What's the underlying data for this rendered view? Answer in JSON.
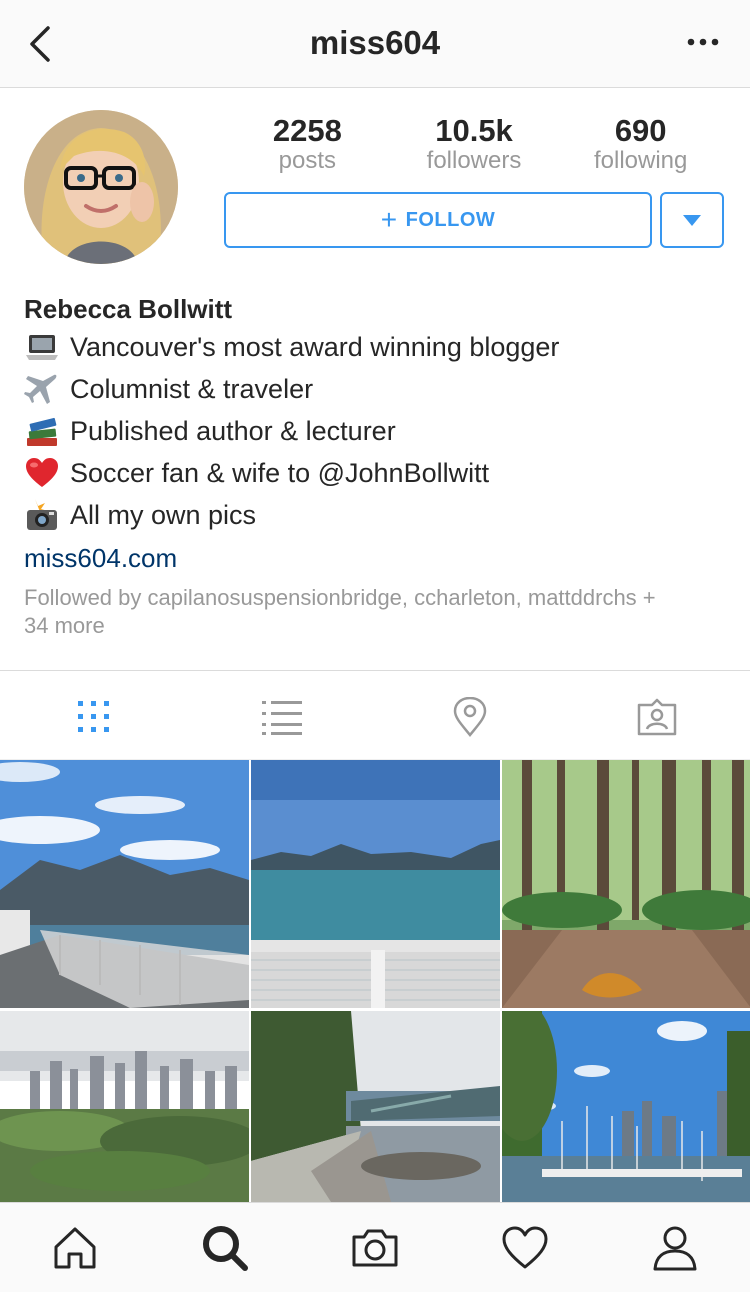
{
  "header": {
    "title": "miss604"
  },
  "profile": {
    "stats": [
      {
        "value": "2258",
        "label": "posts"
      },
      {
        "value": "10.5k",
        "label": "followers"
      },
      {
        "value": "690",
        "label": "following"
      }
    ],
    "follow_label": "FOLLOW",
    "name": "Rebecca Bollwitt",
    "bio_lines": [
      {
        "icon": "laptop-emoji",
        "text": "Vancouver's most award winning blogger"
      },
      {
        "icon": "airplane-emoji",
        "text": "Columnist & traveler"
      },
      {
        "icon": "books-emoji",
        "text": "Published author & lecturer"
      },
      {
        "icon": "heart-emoji",
        "text": "Soccer fan & wife to @JohnBollwitt"
      },
      {
        "icon": "camera-flash-emoji",
        "text": "All my own pics"
      }
    ],
    "website": "miss604.com",
    "followed_by": "Followed by capilanosuspensionbridge, ccharleton, mattddrchs + 34 more"
  },
  "tabs": [
    "grid-view",
    "list-view",
    "location",
    "tagged"
  ],
  "bottom_nav": [
    "home",
    "search",
    "camera",
    "activity",
    "profile"
  ],
  "colors": {
    "accent": "#3897f0",
    "link": "#003569",
    "muted": "#999999"
  }
}
